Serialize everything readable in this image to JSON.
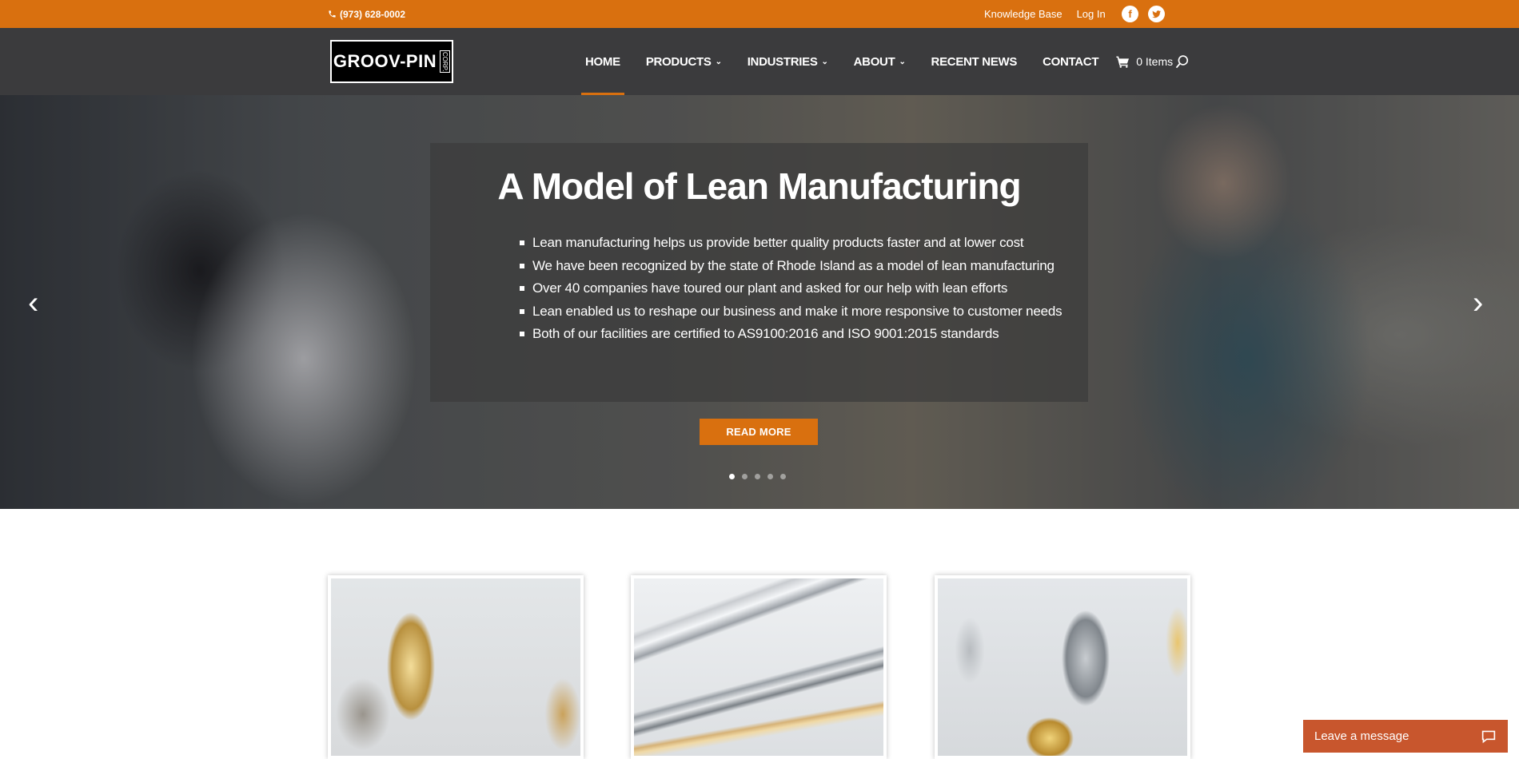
{
  "topbar": {
    "phone": "(973) 628-0002",
    "links": [
      "Knowledge Base",
      "Log In"
    ],
    "social": [
      "facebook-icon",
      "twitter-icon"
    ]
  },
  "logo": {
    "name": "GROOV-PIN",
    "corp": "CORP."
  },
  "nav": {
    "items": [
      {
        "label": "HOME",
        "has_dropdown": false,
        "active": true
      },
      {
        "label": "PRODUCTS",
        "has_dropdown": true
      },
      {
        "label": "INDUSTRIES",
        "has_dropdown": true
      },
      {
        "label": "ABOUT",
        "has_dropdown": true
      },
      {
        "label": "RECENT NEWS",
        "has_dropdown": false
      },
      {
        "label": "CONTACT",
        "has_dropdown": false
      }
    ],
    "cart_label": "0 Items"
  },
  "hero": {
    "title": "A Model of Lean Manufacturing",
    "bullets": [
      "Lean manufacturing helps us provide better quality products faster and at lower cost",
      "We have been recognized by the state of Rhode Island as a model of lean manufacturing",
      "Over 40 companies have toured our plant and asked for our help with lean efforts",
      "Lean enabled us to reshape our business and make it more responsive to customer needs",
      "Both of our facilities are certified to AS9100:2016 and ISO 9001:2015 standards"
    ],
    "button_label": "READ MORE",
    "slide_count": 5,
    "active_slide": 1
  },
  "chat": {
    "label": "Leave a message"
  },
  "colors": {
    "accent": "#d9700f",
    "nav_bg": "#3b3b3d",
    "chat": "#c8562d"
  }
}
